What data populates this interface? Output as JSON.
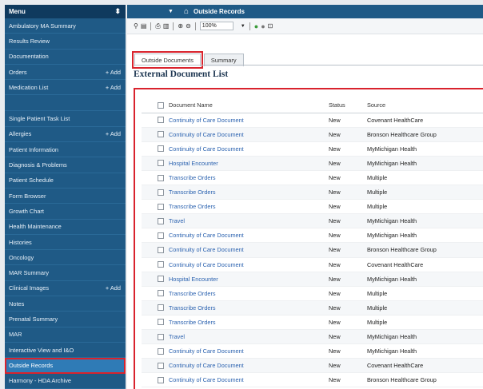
{
  "sidebar": {
    "header": "Menu",
    "pin_glyph": "⬍",
    "items": [
      {
        "label": "Ambulatory MA Summary",
        "add": ""
      },
      {
        "label": "Results Review",
        "add": ""
      },
      {
        "label": "Documentation",
        "add": ""
      },
      {
        "label": "Orders",
        "add": "+ Add"
      },
      {
        "label": "Medication List",
        "add": "+ Add"
      },
      {
        "label": "",
        "add": "",
        "gap": true
      },
      {
        "label": "Single Patient Task List",
        "add": ""
      },
      {
        "label": "Allergies",
        "add": "+ Add"
      },
      {
        "label": "Patient Information",
        "add": ""
      },
      {
        "label": "Diagnosis & Problems",
        "add": ""
      },
      {
        "label": "Patient Schedule",
        "add": ""
      },
      {
        "label": "Form Browser",
        "add": ""
      },
      {
        "label": "Growth Chart",
        "add": ""
      },
      {
        "label": "Health Maintenance",
        "add": ""
      },
      {
        "label": "Histories",
        "add": ""
      },
      {
        "label": "Oncology",
        "add": ""
      },
      {
        "label": "MAR Summary",
        "add": ""
      },
      {
        "label": "Clinical Images",
        "add": "+ Add"
      },
      {
        "label": "Notes",
        "add": ""
      },
      {
        "label": "Prenatal Summary",
        "add": ""
      },
      {
        "label": "MAR",
        "add": ""
      },
      {
        "label": "Interactive View and I&O",
        "add": ""
      },
      {
        "label": "Outside Records",
        "add": "",
        "active": true
      },
      {
        "label": "Harmony - HDA Archive",
        "add": ""
      }
    ]
  },
  "titlebar": {
    "title": "Outside Records"
  },
  "toolbar": {
    "zoom_value": "100%"
  },
  "tabs": [
    {
      "label": "Outside Documents",
      "active": true
    },
    {
      "label": "Summary",
      "active": false
    }
  ],
  "heading": "External Document List",
  "table": {
    "columns": [
      "Document Name",
      "Status",
      "Source"
    ],
    "rows": [
      [
        "Continuity of Care Document",
        "New",
        "Covenant HealthCare"
      ],
      [
        "Continuity of Care Document",
        "New",
        "Bronson Healthcare Group"
      ],
      [
        "Continuity of Care Document",
        "New",
        "MyMichigan Health"
      ],
      [
        "Hospital Encounter",
        "New",
        "MyMichigan Health"
      ],
      [
        "Transcribe Orders",
        "New",
        "Multiple"
      ],
      [
        "Transcribe Orders",
        "New",
        "Multiple"
      ],
      [
        "Transcribe Orders",
        "New",
        "Multiple"
      ],
      [
        "Travel",
        "New",
        "MyMichigan Health"
      ],
      [
        "Continuity of Care Document",
        "New",
        "MyMichigan Health"
      ],
      [
        "Continuity of Care Document",
        "New",
        "Bronson Healthcare Group"
      ],
      [
        "Continuity of Care Document",
        "New",
        "Covenant HealthCare"
      ],
      [
        "Hospital Encounter",
        "New",
        "MyMichigan Health"
      ],
      [
        "Transcribe Orders",
        "New",
        "Multiple"
      ],
      [
        "Transcribe Orders",
        "New",
        "Multiple"
      ],
      [
        "Transcribe Orders",
        "New",
        "Multiple"
      ],
      [
        "Travel",
        "New",
        "MyMichigan Health"
      ],
      [
        "Continuity of Care Document",
        "New",
        "MyMichigan Health"
      ],
      [
        "Continuity of Care Document",
        "New",
        "Covenant HealthCare"
      ],
      [
        "Continuity of Care Document",
        "New",
        "Bronson Healthcare Group"
      ]
    ]
  },
  "colors": {
    "sidebar_bg": "#1f5a86",
    "header_bg": "#0f3a5e",
    "link": "#2c63b0",
    "highlight": "#d9232d"
  }
}
